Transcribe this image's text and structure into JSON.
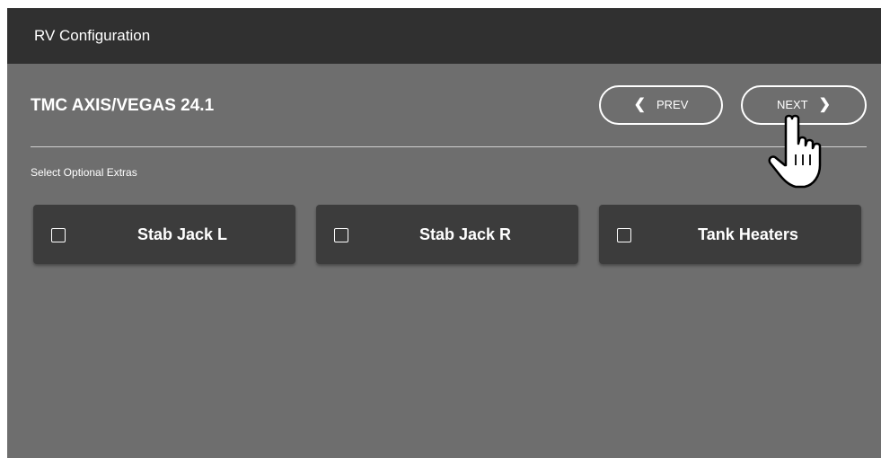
{
  "window": {
    "title": "RV Configuration"
  },
  "header": {
    "title": "TMC AXIS/VEGAS 24.1",
    "prev_label": "PREV",
    "next_label": "NEXT",
    "prev_icon": "chevron-left-icon",
    "next_icon": "chevron-right-icon"
  },
  "section": {
    "label": "Select Optional Extras"
  },
  "options": [
    {
      "label": "Stab Jack L",
      "checked": false
    },
    {
      "label": "Stab Jack R",
      "checked": false
    },
    {
      "label": "Tank Heaters",
      "checked": false
    }
  ],
  "colors": {
    "titlebar": "#303030",
    "background": "#6e6e6e",
    "card": "#3c3c3c",
    "text": "#ffffff"
  },
  "cursor": {
    "icon": "hand-pointer-icon"
  }
}
